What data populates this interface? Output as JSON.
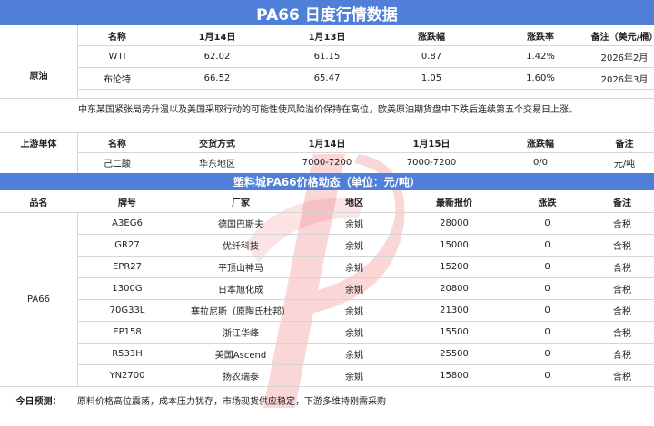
{
  "title": "PA66 日度行情数据",
  "crude": {
    "section_label": "原油",
    "headers": [
      "名称",
      "1月14日",
      "1月13日",
      "涨跌幅",
      "涨跌率",
      "备注（美元/桶）"
    ],
    "rows": [
      [
        "WTI",
        "62.02",
        "61.15",
        "0.87",
        "1.42%",
        "2026年2月"
      ],
      [
        "布伦特",
        "66.52",
        "65.47",
        "1.05",
        "1.60%",
        "2026年3月"
      ]
    ],
    "note": "中东某国紧张局势升温以及美国采取行动的可能性使风险溢价保持在高位，欧美原油期货盘中下跌后连续第五个交易日上涨。"
  },
  "upstream": {
    "section_label": "上游单体",
    "headers": [
      "名称",
      "交货方式",
      "1月14日",
      "1月15日",
      "涨跌幅",
      "备注"
    ],
    "rows": [
      [
        "己二酸",
        "华东地区",
        "7000-7200",
        "7000-7200",
        "0/0",
        "元/吨"
      ]
    ]
  },
  "plastics": {
    "bar_title": "塑料城PA66价格动态（单位：元/吨）",
    "headers": [
      "品名",
      "牌号",
      "厂家",
      "地区",
      "最新报价",
      "涨跌",
      "备注"
    ],
    "product": "PA66",
    "rows": [
      [
        "A3EG6",
        "德国巴斯夫",
        "余姚",
        "28000",
        "0",
        "含税"
      ],
      [
        "GR27",
        "优纤科技",
        "余姚",
        "15000",
        "0",
        "含税"
      ],
      [
        "EPR27",
        "平顶山神马",
        "余姚",
        "15200",
        "0",
        "含税"
      ],
      [
        "1300G",
        "日本旭化成",
        "余姚",
        "20800",
        "0",
        "含税"
      ],
      [
        "70G33L",
        "塞拉尼斯（原陶氏杜邦）",
        "余姚",
        "21300",
        "0",
        "含税"
      ],
      [
        "EP158",
        "浙江华峰",
        "余姚",
        "15500",
        "0",
        "含税"
      ],
      [
        "R533H",
        "美国Ascend",
        "余姚",
        "25500",
        "0",
        "含税"
      ],
      [
        "YN2700",
        "扬农瑞泰",
        "余姚",
        "15800",
        "0",
        "含税"
      ]
    ]
  },
  "forecast": {
    "label": "今日预测：",
    "text": "原料价格高位震荡，成本压力犹存，市场现货供应稳定，下游多维持刚需采购"
  },
  "colors": {
    "header_bar": "#4f7fd9",
    "watermark": "#e8464b"
  }
}
